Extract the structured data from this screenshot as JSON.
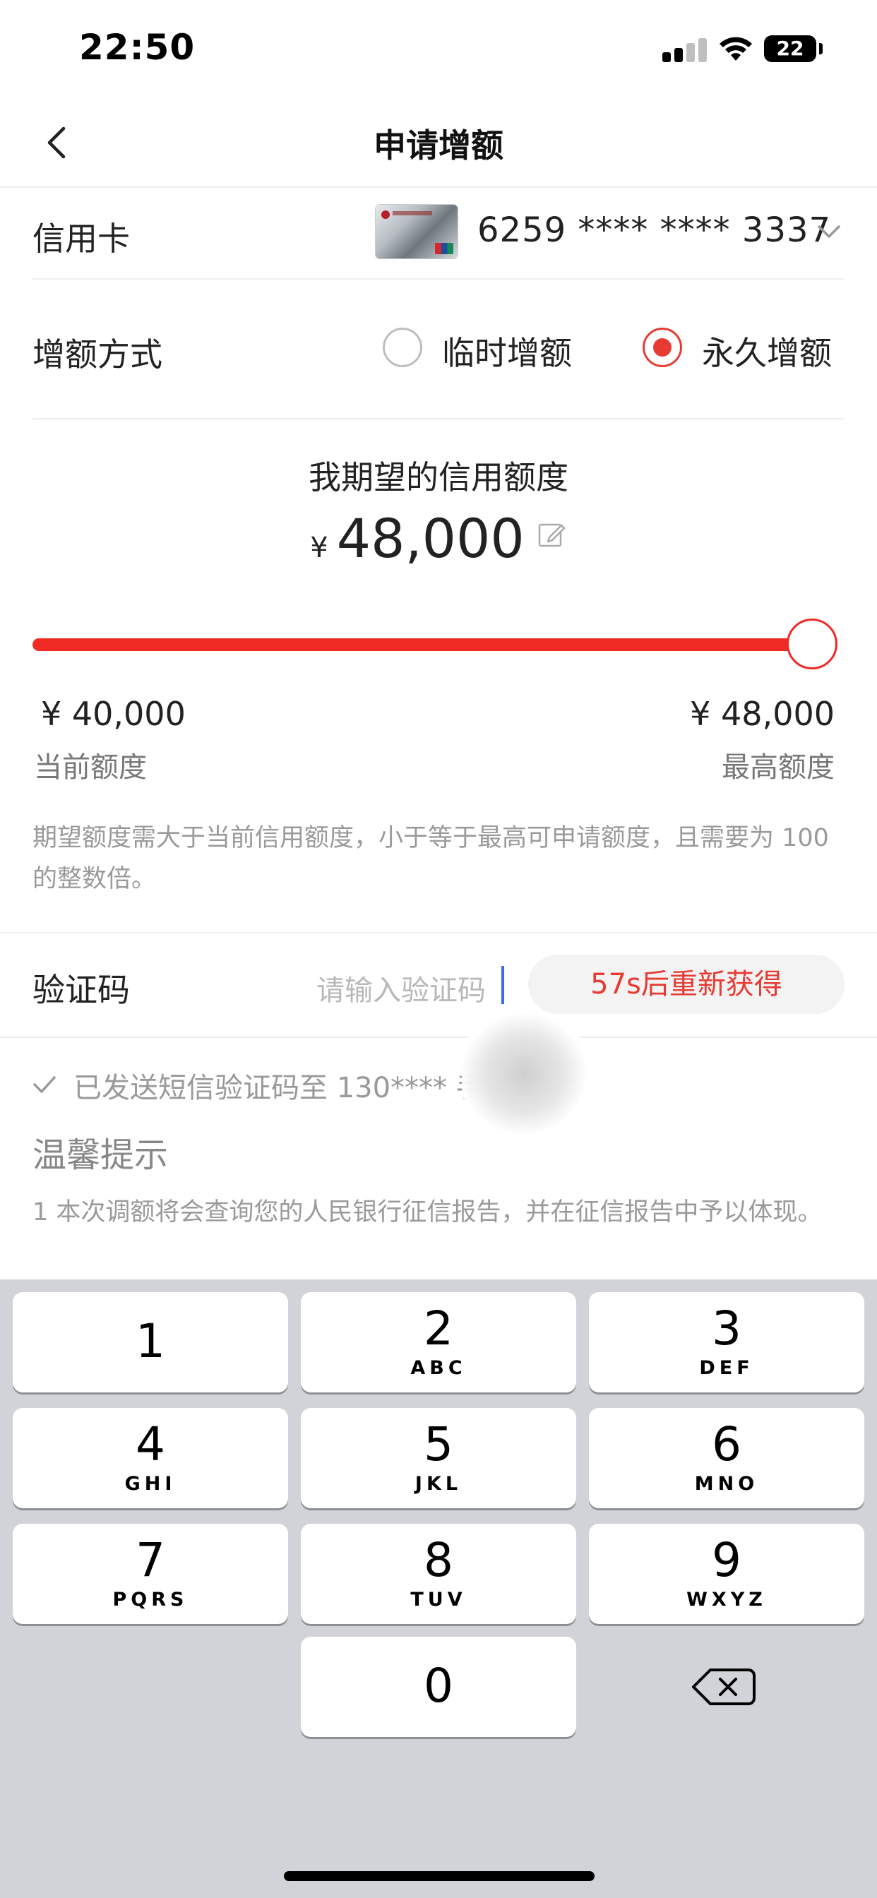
{
  "status_bar": {
    "time": "22:50",
    "battery": "22"
  },
  "nav": {
    "title": "申请增额"
  },
  "card": {
    "label": "信用卡",
    "number": "6259 **** **** 3337"
  },
  "method": {
    "label": "增额方式",
    "options": [
      "临时增额",
      "永久增额"
    ],
    "selected": "永久增额"
  },
  "amount": {
    "title": "我期望的信用额度",
    "currency": "¥",
    "value": "48,000"
  },
  "slider": {
    "value_fraction": 1.0
  },
  "limits": {
    "current_value": "¥ 40,000",
    "current_label": "当前额度",
    "max_value": "¥ 48,000",
    "max_label": "最高额度"
  },
  "hint": "期望额度需大于当前信用额度，小于等于最高可申请额度，且需要为 100 的整数倍。",
  "verify": {
    "label": "验证码",
    "placeholder": "请输入验证码",
    "resend": "57s后重新获得"
  },
  "sent_notice": "已发送短信验证码至 130****       手机",
  "tips": {
    "title": "温馨提示",
    "body": "1 本次调额将会查询您的人民银行征信报告，并在征信报告中予以体现。"
  },
  "keyboard": {
    "keys": [
      {
        "num": "1",
        "letters": ""
      },
      {
        "num": "2",
        "letters": "ABC"
      },
      {
        "num": "3",
        "letters": "DEF"
      },
      {
        "num": "4",
        "letters": "GHI"
      },
      {
        "num": "5",
        "letters": "JKL"
      },
      {
        "num": "6",
        "letters": "MNO"
      },
      {
        "num": "7",
        "letters": "PQRS"
      },
      {
        "num": "8",
        "letters": "TUV"
      },
      {
        "num": "9",
        "letters": "WXYZ"
      },
      {
        "num": "0",
        "letters": ""
      }
    ]
  },
  "colors": {
    "accent": "#e73a32",
    "slider": "#ef2a25",
    "caret": "#3a6cf0",
    "keyboard_bg": "#d1d3d9"
  },
  "icons": [
    "back-icon",
    "chevron-down-icon",
    "edit-icon",
    "check-icon",
    "delete-icon",
    "wifi-icon",
    "signal-icon",
    "battery-icon"
  ]
}
